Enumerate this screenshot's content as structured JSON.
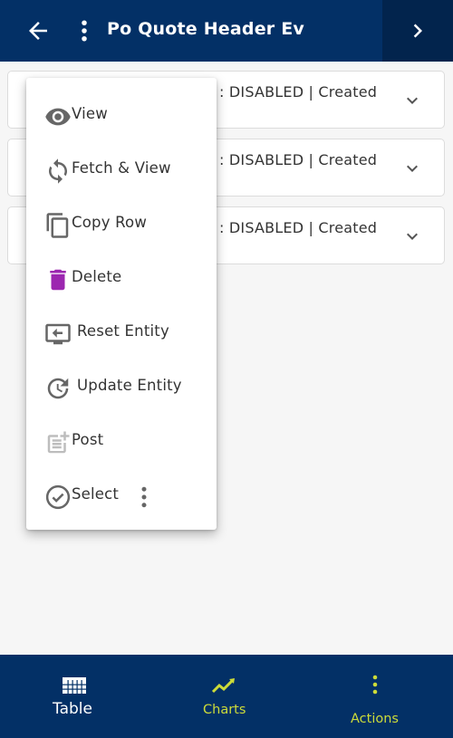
{
  "header": {
    "title": "Po Quote Header Ev",
    "back_icon": "arrow-left-icon",
    "more_icon": "more-vertical-icon",
    "next_icon": "chevron-right-icon"
  },
  "rows": [
    {
      "text": ": DISABLED | Created"
    },
    {
      "text": ": DISABLED | Created"
    },
    {
      "text": ": DISABLED | Created"
    }
  ],
  "menu": {
    "items": [
      {
        "label": "View",
        "icon": "eye-icon"
      },
      {
        "label": "Fetch & View",
        "icon": "refresh-icon"
      },
      {
        "label": "Copy Row",
        "icon": "copy-icon"
      },
      {
        "label": "Delete",
        "icon": "trash-icon"
      },
      {
        "label": "Reset Entity",
        "icon": "reset-screen-icon"
      },
      {
        "label": "Update Entity",
        "icon": "history-icon"
      },
      {
        "label": "Post",
        "icon": "post-add-icon"
      },
      {
        "label": "Select",
        "icon": "check-circle-icon"
      }
    ]
  },
  "bottom_nav": {
    "tabs": [
      {
        "label": "Table",
        "icon": "grid-icon",
        "color": "#ffffff"
      },
      {
        "label": "Charts",
        "icon": "trend-line-icon",
        "color": "#cddc39"
      },
      {
        "label": "Actions",
        "icon": "more-vertical-icon",
        "color": "#cddc39"
      }
    ]
  },
  "colors": {
    "primary": "#033066",
    "accent": "#cddc39",
    "delete": "#9c27b0",
    "icon_gray": "#666666"
  }
}
